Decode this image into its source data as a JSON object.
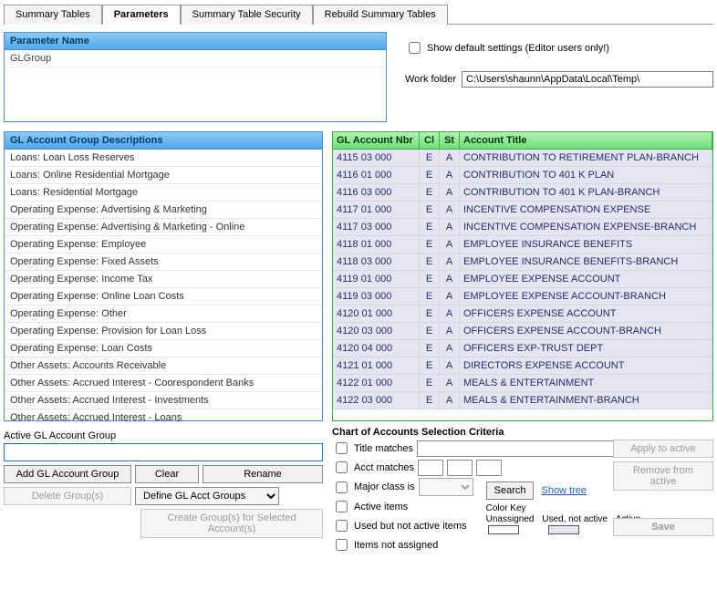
{
  "tabs": {
    "summary_tables": "Summary Tables",
    "parameters": "Parameters",
    "summary_table_security": "Summary Table Security",
    "rebuild_summary_tables": "Rebuild Summary Tables"
  },
  "parameter_panel": {
    "header": "Parameter Name",
    "rows": [
      "GLGroup"
    ]
  },
  "show_default_label": "Show default settings (Editor users only!)",
  "work_folder_label": "Work folder",
  "work_folder_value": "C:\\Users\\shaunn\\AppData\\Local\\Temp\\",
  "desc_panel": {
    "header": "GL Account Group Descriptions",
    "rows": [
      "Loans:  Loan Loss Reserves",
      "Loans:  Online Residential Mortgage",
      "Loans:  Residential Mortgage",
      "Operating Expense:  Advertising & Marketing",
      "Operating Expense:  Advertising & Marketing - Online",
      "Operating Expense:  Employee",
      "Operating Expense:  Fixed Assets",
      "Operating Expense:  Income Tax",
      "Operating Expense:  Online Loan Costs",
      "Operating Expense:  Other",
      "Operating Expense:  Provision for Loan Loss",
      "Operating Expense: Loan Costs",
      "Other Assets:  Accounts Receivable",
      "Other Assets:  Accrued Interest - Coorespondent Banks",
      "Other Assets:  Accrued Interest - Investments",
      "Other Assets:  Accrued Interest - Loans"
    ]
  },
  "accounts": {
    "headers": {
      "nbr": "GL Account Nbr",
      "cl": "Cl",
      "st": "St",
      "title": "Account Title"
    },
    "rows": [
      {
        "nbr": "4115 03 000",
        "cl": "E",
        "st": "A",
        "title": "CONTRIBUTION TO RETIREMENT PLAN-BRANCH"
      },
      {
        "nbr": "4116 01 000",
        "cl": "E",
        "st": "A",
        "title": "CONTRIBUTION TO 401 K PLAN"
      },
      {
        "nbr": "4116 03 000",
        "cl": "E",
        "st": "A",
        "title": "CONTRIBUTION TO 401 K PLAN-BRANCH"
      },
      {
        "nbr": "4117 01 000",
        "cl": "E",
        "st": "A",
        "title": "INCENTIVE COMPENSATION EXPENSE"
      },
      {
        "nbr": "4117 03 000",
        "cl": "E",
        "st": "A",
        "title": "INCENTIVE COMPENSATION EXPENSE-BRANCH"
      },
      {
        "nbr": "4118 01 000",
        "cl": "E",
        "st": "A",
        "title": "EMPLOYEE INSURANCE BENEFITS"
      },
      {
        "nbr": "4118 03 000",
        "cl": "E",
        "st": "A",
        "title": "EMPLOYEE INSURANCE BENEFITS-BRANCH"
      },
      {
        "nbr": "4119 01 000",
        "cl": "E",
        "st": "A",
        "title": "EMPLOYEE EXPENSE ACCOUNT"
      },
      {
        "nbr": "4119 03 000",
        "cl": "E",
        "st": "A",
        "title": "EMPLOYEE EXPENSE ACCOUNT-BRANCH"
      },
      {
        "nbr": "4120 01 000",
        "cl": "E",
        "st": "A",
        "title": "OFFICERS EXPENSE ACCOUNT"
      },
      {
        "nbr": "4120 03 000",
        "cl": "E",
        "st": "A",
        "title": "OFFICERS EXPENSE ACCOUNT-BRANCH"
      },
      {
        "nbr": "4120 04 000",
        "cl": "E",
        "st": "A",
        "title": "OFFICERS EXP-TRUST DEPT"
      },
      {
        "nbr": "4121 01 000",
        "cl": "E",
        "st": "A",
        "title": "DIRECTORS EXPENSE ACCOUNT"
      },
      {
        "nbr": "4122 01 000",
        "cl": "E",
        "st": "A",
        "title": "MEALS & ENTERTAINMENT"
      },
      {
        "nbr": "4122 03 000",
        "cl": "E",
        "st": "A",
        "title": "MEALS & ENTERTAINMENT-BRANCH"
      }
    ]
  },
  "active_group": {
    "label": "Active GL Account Group",
    "value": ""
  },
  "buttons": {
    "add": "Add GL Account Group",
    "clear": "Clear",
    "rename": "Rename",
    "delete": "Delete Group(s)",
    "define": "Define GL Acct Groups",
    "create_groups": "Create Group(s) for Selected Account(s)",
    "apply": "Apply to active",
    "remove": "Remove from active",
    "save": "Save",
    "search": "Search",
    "show_tree": "Show tree"
  },
  "criteria": {
    "title": "Chart of Accounts Selection Criteria",
    "title_matches": "Title matches",
    "acct_matches": "Acct matches",
    "major_class": "Major class is",
    "active_items": "Active items",
    "used_not_active": "Used but not active items",
    "not_assigned": "Items not assigned",
    "color_key": "Color Key",
    "unassigned": "Unassigned",
    "used_na": "Used, not active",
    "active": "Active"
  }
}
